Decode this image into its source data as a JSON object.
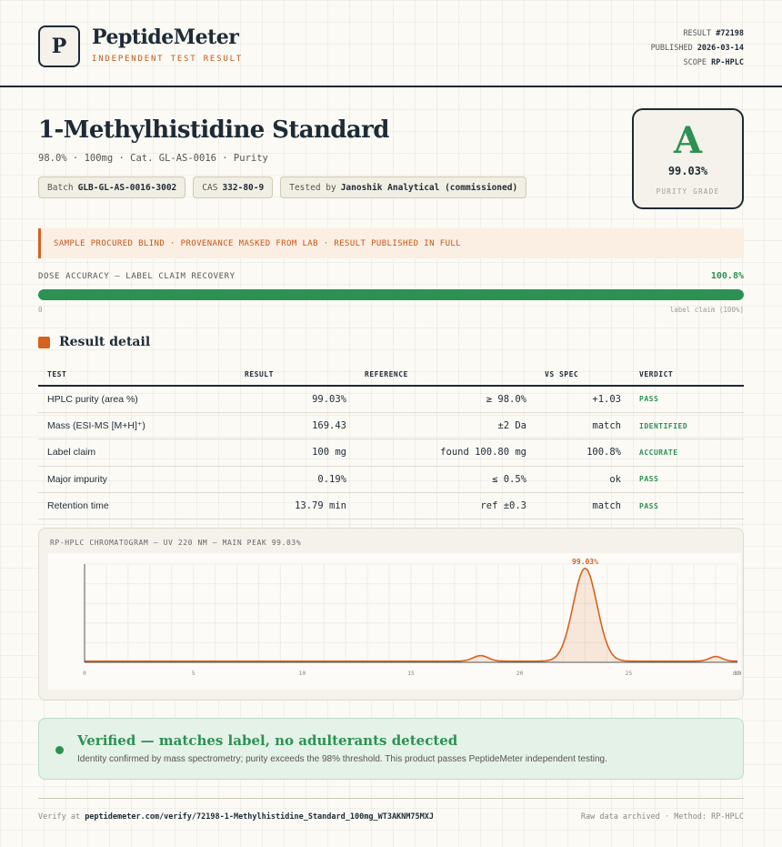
{
  "header": {
    "logo_letter": "P",
    "brand": "PeptideMeter",
    "subtitle": "INDEPENDENT TEST RESULT",
    "meta": {
      "result_label": "RESULT",
      "result_value": "#72198",
      "published_label": "PUBLISHED",
      "published_value": "2026-03-14",
      "scope_label": "SCOPE",
      "scope_value": "RP-HPLC"
    }
  },
  "product": {
    "title": "1-Methylhistidine Standard",
    "subtitle": "98.0% · 100mg · Cat. GL-AS-0016 · Purity",
    "chips": [
      {
        "label": "Batch",
        "value": "GLB-GL-AS-0016-3002"
      },
      {
        "label": "CAS",
        "value": "332-80-9"
      },
      {
        "label": "Tested by",
        "value": "Janoshik Analytical (commissioned)"
      }
    ]
  },
  "grade": {
    "letter": "A",
    "value": "99.03%",
    "label": "PURITY GRADE"
  },
  "banner": {
    "text": "SAMPLE PROCURED BLIND · PROVENANCE MASKED FROM LAB · RESULT PUBLISHED IN FULL"
  },
  "dose": {
    "label": "DOSE ACCURACY — LABEL CLAIM RECOVERY",
    "value_text": "100.8%",
    "fraction": 1.0,
    "min_label": "0",
    "max_label": "label claim (100%)"
  },
  "results": {
    "section_title": "Result detail",
    "headers": [
      "TEST",
      "RESULT",
      "REFERENCE",
      "VS SPEC",
      "VERDICT"
    ],
    "rows": [
      {
        "test": "HPLC purity (area %)",
        "result": "99.03%",
        "reference": "≥ 98.0%",
        "vs_spec": "+1.03",
        "verdict": "PASS"
      },
      {
        "test": "Mass (ESI-MS [M+H]⁺)",
        "result": "169.43",
        "reference": "±2 Da",
        "vs_spec": "match",
        "verdict": "IDENTIFIED"
      },
      {
        "test": "Label claim",
        "result": "100 mg",
        "reference": "found 100.80 mg",
        "vs_spec": "100.8%",
        "verdict": "ACCURATE"
      },
      {
        "test": "Major impurity",
        "result": "0.19%",
        "reference": "≤ 0.5%",
        "vs_spec": "ok",
        "verdict": "PASS"
      },
      {
        "test": "Retention time",
        "result": "13.79 min",
        "reference": "ref ±0.3",
        "vs_spec": "match",
        "verdict": "PASS"
      }
    ]
  },
  "chart_data": {
    "type": "line",
    "title": "RP-HPLC CHROMATOGRAM — UV 220 NM — MAIN PEAK 99.03%",
    "xlabel": "",
    "ylabel": "",
    "xlim": [
      0,
      30
    ],
    "x_ticks": [
      "0",
      "5",
      "10",
      "15",
      "20",
      "25",
      "30"
    ],
    "x_unit_label": "min",
    "peaks": [
      {
        "x": 18.2,
        "height": 0.06,
        "width": 0.35
      },
      {
        "x": 23.0,
        "height": 1.0,
        "width": 0.55,
        "label": "99.03%"
      },
      {
        "x": 29.0,
        "height": 0.05,
        "width": 0.3
      }
    ],
    "baseline": 0.012,
    "color": "#d6621f"
  },
  "verified": {
    "title": "Verified — matches label, no adulterants detected",
    "text": "Identity confirmed by mass spectrometry; purity exceeds the 98% threshold. This product passes PeptideMeter independent testing."
  },
  "footer": {
    "verify_label": "Verify at",
    "verify_url": "peptidemeter.com/verify/72198-1-Methylhistidine_Standard_100mg_WT3AKNM75MXJ",
    "right": "Raw data archived · Method: RP-HPLC"
  }
}
